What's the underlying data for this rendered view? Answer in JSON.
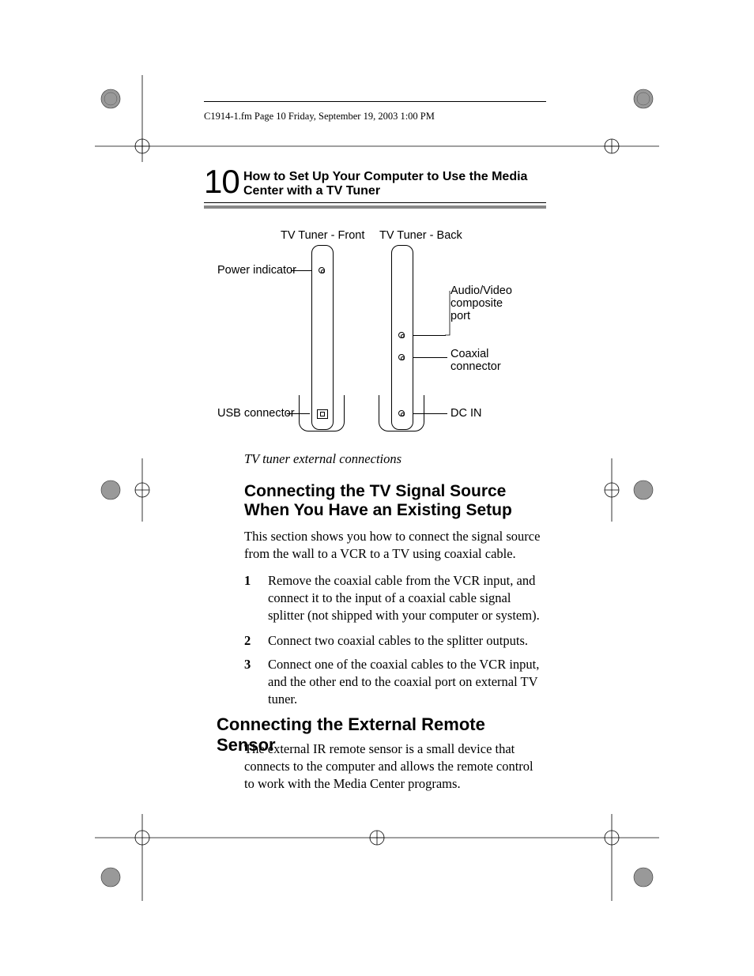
{
  "header": {
    "running_line": "C1914-1.fm  Page 10  Friday, September 19, 2003  1:00 PM"
  },
  "section": {
    "number": "10",
    "title": "How to Set Up Your Computer to Use the Media Center with a TV Tuner"
  },
  "diagram": {
    "front_label": "TV Tuner - Front",
    "back_label": "TV Tuner - Back",
    "power_indicator": "Power indicator",
    "usb_connector": "USB connector",
    "av_port_line1": "Audio/Video",
    "av_port_line2": "composite",
    "av_port_line3": "port",
    "coax_line1": "Coaxial",
    "coax_line2": "connector",
    "dc_in": "DC IN",
    "caption": "TV tuner external connections"
  },
  "subheading_a": "Connecting the TV Signal Source When You Have an Existing Setup",
  "paragraph_a": "This section shows you how to connect the signal source from the wall to a VCR to a TV using coaxial cable.",
  "steps": {
    "n1": "1",
    "t1": "Remove the coaxial cable from the VCR input, and connect it to the input of a coaxial cable signal splitter (not shipped with your computer or system).",
    "n2": "2",
    "t2": "Connect two coaxial cables to the splitter outputs.",
    "n3": "3",
    "t3": "Connect one of the coaxial cables to the VCR input, and the other end to the coaxial port on external TV tuner."
  },
  "subheading_b": "Connecting the External Remote Sensor",
  "paragraph_b": "The external IR remote sensor is a small device that connects to the computer and allows the remote control to work with the Media Center programs."
}
